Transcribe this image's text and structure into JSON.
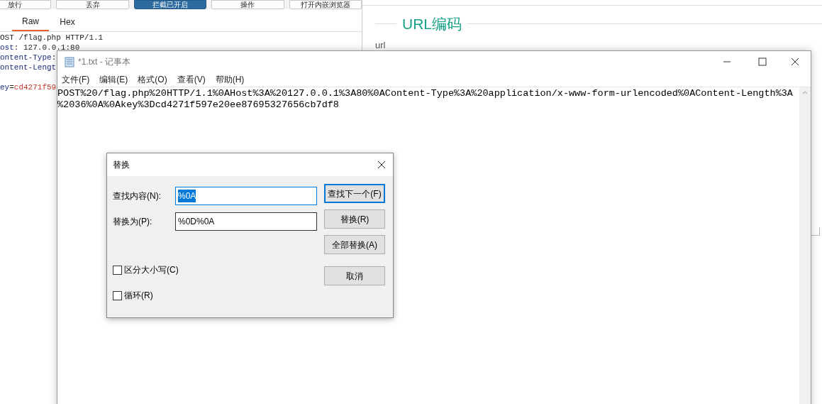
{
  "burp": {
    "toolbar_buttons": [
      {
        "label": "放行",
        "selected": false
      },
      {
        "label": "丢弃",
        "selected": false
      },
      {
        "label": "拦截已开启",
        "selected": true
      },
      {
        "label": "操作",
        "selected": false
      },
      {
        "label": "打开内嵌浏览器",
        "selected": false
      }
    ],
    "tabs": [
      {
        "label": "Raw",
        "selected": true
      },
      {
        "label": "Hex",
        "selected": false
      }
    ],
    "request_lines": [
      {
        "kind": "request",
        "text": "OST /flag.php HTTP/1.1"
      },
      {
        "kind": "header",
        "name": "ost",
        "separator": ":",
        "value": " 127.0.0.1:80"
      },
      {
        "kind": "header",
        "name": "ontent-Type",
        "separator": ":"
      },
      {
        "kind": "header",
        "name": "ontent-Lengt"
      },
      {
        "kind": "blank"
      },
      {
        "kind": "param",
        "name": "ey",
        "separator": "=",
        "value": "cd4271f59"
      }
    ]
  },
  "tool_panel": {
    "heading": "URL编码",
    "field_label": "url"
  },
  "notepad": {
    "title": "*1.txt - 记事本",
    "menu": [
      "文件(F)",
      "编辑(E)",
      "格式(O)",
      "查看(V)",
      "帮助(H)"
    ],
    "lines": [
      "POST%20/flag.php%20HTTP/1.1%0AHost%3A%20127.0.0.1%3A80%0AContent-Type%3A%20application/x-www-form-urlencoded%0AContent-Length%3A",
      "%2036%0A%0Akey%3Dcd4271f597e20ee87695327656cb7df8"
    ]
  },
  "replace_dialog": {
    "title": "替换",
    "fields": [
      {
        "label": "查找内容(N):",
        "value": "%0A",
        "focused": true
      },
      {
        "label": "替换为(P):",
        "value": "%0D%0A",
        "focused": false
      }
    ],
    "buttons": [
      {
        "label": "查找下一个(F)",
        "default": true
      },
      {
        "label": "替换(R)",
        "default": false
      },
      {
        "label": "全部替换(A)",
        "default": false
      },
      {
        "label": "取消",
        "default": false
      }
    ],
    "options": [
      {
        "label": "区分大小写(C)",
        "checked": false
      },
      {
        "label": "循环(R)",
        "checked": false
      }
    ]
  }
}
